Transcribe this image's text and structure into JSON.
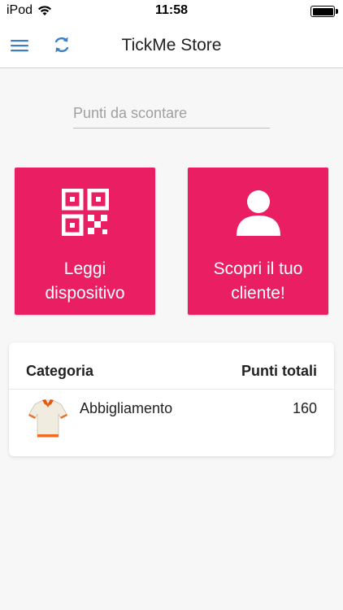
{
  "status_bar": {
    "carrier": "iPod",
    "time": "11:58",
    "battery_level": 1.0
  },
  "header": {
    "title": "TickMe Store",
    "menu_icon": "hamburger-menu-icon",
    "refresh_icon": "refresh-icon"
  },
  "points_input": {
    "placeholder": "Punti da scontare",
    "value": ""
  },
  "actions": {
    "read_device": {
      "label": "Leggi dispositivo",
      "icon": "qr-code-icon"
    },
    "find_customer": {
      "label": "Scopri il tuo cliente!",
      "icon": "user-icon"
    }
  },
  "table": {
    "headers": {
      "category": "Categoria",
      "points": "Punti totali"
    },
    "rows": [
      {
        "category": "Abbigliamento",
        "points": "160",
        "icon": "shirt-icon"
      }
    ]
  },
  "colors": {
    "accent": "#e91e63",
    "header_icons": "#3f7fc1",
    "background": "#f7f7f7"
  }
}
